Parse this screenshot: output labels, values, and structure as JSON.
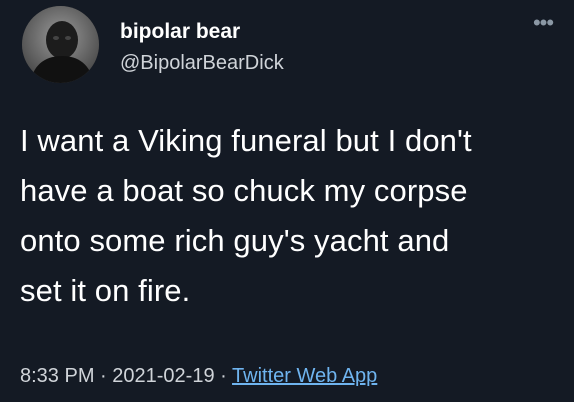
{
  "tweet": {
    "author": {
      "display_name": "bipolar bear",
      "handle": "@BipolarBearDick",
      "avatar_icon": "avatar-photo"
    },
    "more_icon": "more-options-icon",
    "text_lines": [
      "I want a Viking funeral but I don't",
      "have a boat so chuck my corpse",
      "onto some rich guy's yacht and",
      "set it on fire."
    ],
    "meta": {
      "time": "8:33 PM",
      "separator": "·",
      "date": "2021-02-19",
      "source": "Twitter Web App"
    }
  },
  "colors": {
    "background": "#141a24",
    "text": "#ffffff",
    "secondary_text": "#d0d4d9",
    "link": "#6fb4ef"
  }
}
